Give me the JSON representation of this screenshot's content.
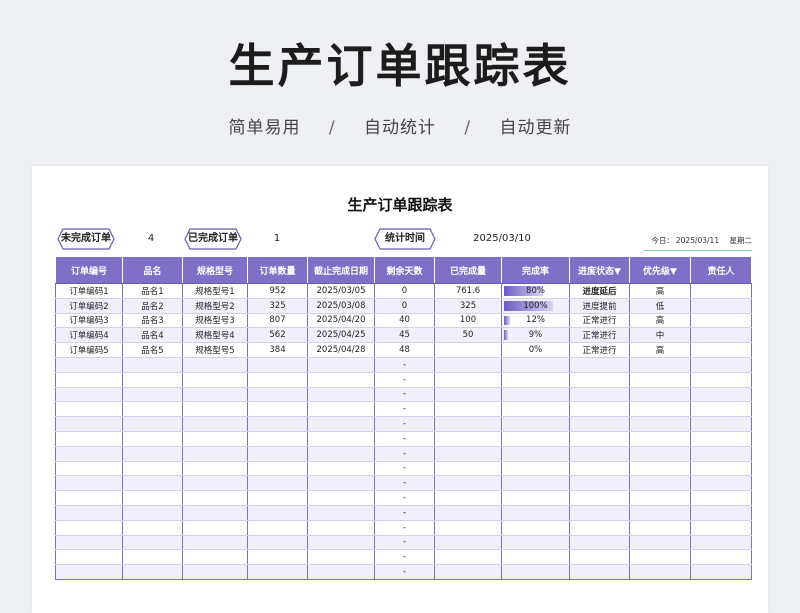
{
  "hero": {
    "title": "生产订单跟踪表",
    "subtitle_parts": [
      "简单易用",
      "自动统计",
      "自动更新"
    ],
    "separator": "/"
  },
  "sheet": {
    "title": "生产订单跟踪表",
    "stats": {
      "unfinished_label": "未完成订单",
      "unfinished_value": "4",
      "finished_label": "已完成订单",
      "finished_value": "1",
      "stat_time_label": "统计时间",
      "stat_time_value": "2025/03/10"
    },
    "today_label": "今日：",
    "today_date": "2025/03/11",
    "today_weekday": "星期二"
  },
  "table": {
    "headers": [
      "订单编号",
      "品名",
      "规格型号",
      "订单数量",
      "截止完成日期",
      "剩余天数",
      "已完成量",
      "完成率",
      "进度状态▼",
      "优先级▼",
      "责任人"
    ],
    "rows": [
      {
        "id": "订单编码1",
        "name": "品名1",
        "spec": "规格型号1",
        "qty": "952",
        "due": "2025/03/05",
        "days": "0",
        "done": "761.6",
        "rate_text": "80%",
        "rate": 0.8,
        "status": "进度延后",
        "late": true,
        "priority": "高",
        "owner": ""
      },
      {
        "id": "订单编码2",
        "name": "品名2",
        "spec": "规格型号2",
        "qty": "325",
        "due": "2025/03/08",
        "days": "0",
        "done": "325",
        "rate_text": "100%",
        "rate": 1.0,
        "status": "进度提前",
        "late": false,
        "priority": "低",
        "owner": ""
      },
      {
        "id": "订单编码3",
        "name": "品名3",
        "spec": "规格型号3",
        "qty": "807",
        "due": "2025/04/20",
        "days": "40",
        "done": "100",
        "rate_text": "12%",
        "rate": 0.12,
        "status": "正常进行",
        "late": false,
        "priority": "高",
        "owner": ""
      },
      {
        "id": "订单编码4",
        "name": "品名4",
        "spec": "规格型号4",
        "qty": "562",
        "due": "2025/04/25",
        "days": "45",
        "done": "50",
        "rate_text": "9%",
        "rate": 0.09,
        "status": "正常进行",
        "late": false,
        "priority": "中",
        "owner": ""
      },
      {
        "id": "订单编码5",
        "name": "品名5",
        "spec": "规格型号5",
        "qty": "384",
        "due": "2025/04/28",
        "days": "48",
        "done": "",
        "rate_text": "0%",
        "rate": 0,
        "status": "正常进行",
        "late": false,
        "priority": "高",
        "owner": ""
      }
    ],
    "empty_days_placeholder": "-",
    "empty_rows": 15
  },
  "colors": {
    "header_bg": "#7f6fc6",
    "late_status": "#e02020"
  }
}
